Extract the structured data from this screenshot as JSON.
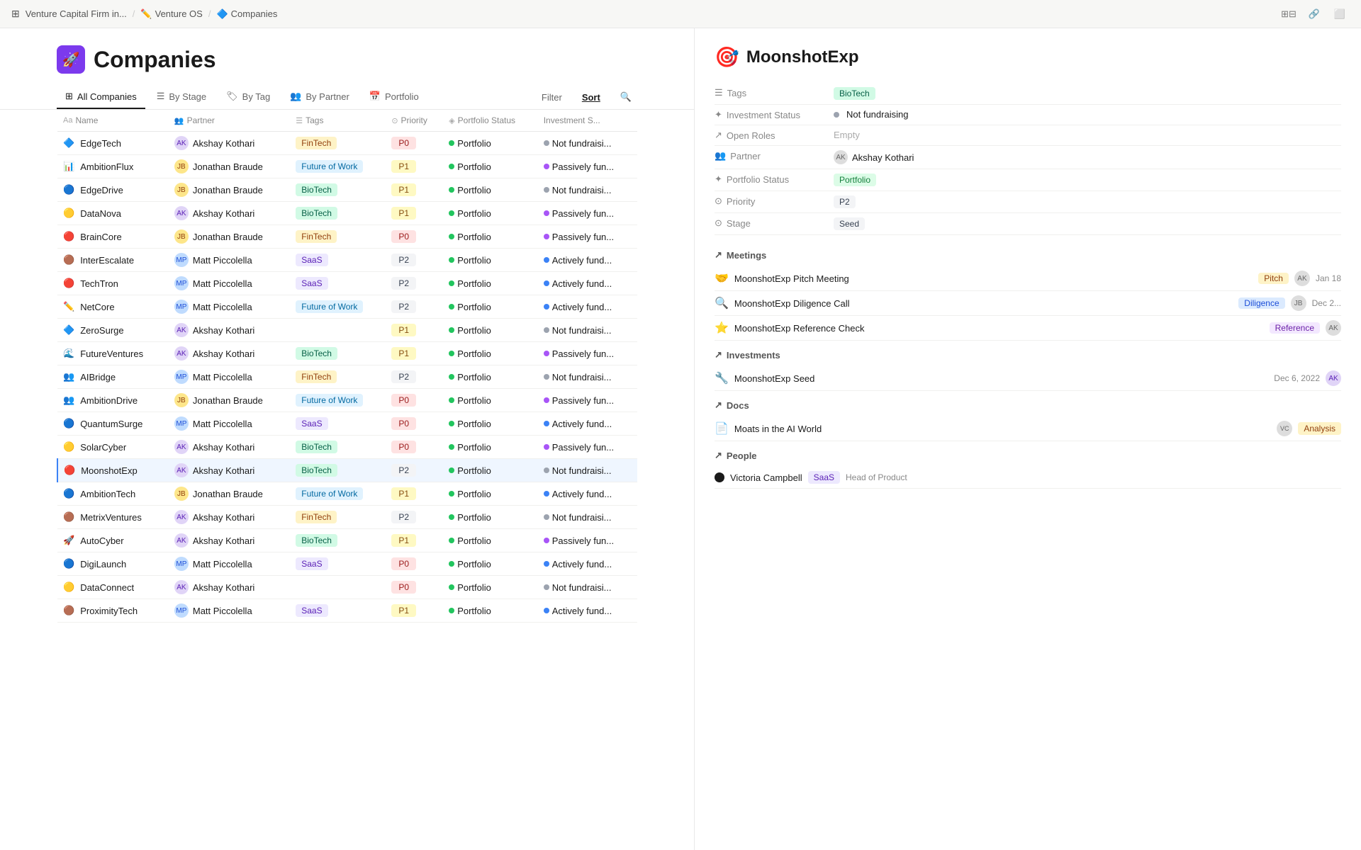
{
  "topbar": {
    "breadcrumbs": [
      "Venture Capital Firm in...",
      "Venture OS",
      "Companies"
    ],
    "icons": [
      "grid-icon",
      "link-icon",
      "layout-icon"
    ]
  },
  "page": {
    "icon": "🚀",
    "title": "Companies"
  },
  "tabs": [
    {
      "label": "All Companies",
      "icon": "⊞",
      "active": true
    },
    {
      "label": "By Stage",
      "icon": "☰",
      "active": false
    },
    {
      "label": "By Tag",
      "icon": "🏷",
      "active": false
    },
    {
      "label": "By Partner",
      "icon": "👥",
      "active": false
    },
    {
      "label": "Portfolio",
      "icon": "📅",
      "active": false
    }
  ],
  "table_actions": {
    "filter": "Filter",
    "sort": "Sort",
    "search_icon": "search-icon"
  },
  "columns": [
    {
      "label": "Name",
      "icon": "Aa"
    },
    {
      "label": "Partner",
      "icon": "👥"
    },
    {
      "label": "Tags",
      "icon": "☰"
    },
    {
      "label": "Priority",
      "icon": "⊙"
    },
    {
      "label": "Portfolio Status",
      "icon": "◈"
    },
    {
      "label": "Investment S..."
    }
  ],
  "rows": [
    {
      "name": "EdgeTech",
      "icon": "🔷",
      "partner": "Akshay Kothari",
      "partner_icon": "AK",
      "tag": "FinTech",
      "tag_class": "tag-fintech",
      "priority": "P0",
      "priority_class": "p0",
      "portfolio": "Portfolio",
      "portfolio_dot": "dot-green",
      "investment": "Not fundraisi...",
      "investment_dot": "dot-gray"
    },
    {
      "name": "AmbitionFlux",
      "icon": "📊",
      "partner": "Jonathan Braude",
      "partner_icon": "JB",
      "tag": "Future of Work",
      "tag_class": "tag-future",
      "priority": "P1",
      "priority_class": "p1",
      "portfolio": "Portfolio",
      "portfolio_dot": "dot-green",
      "investment": "Passively fun...",
      "investment_dot": "dot-purple"
    },
    {
      "name": "EdgeDrive",
      "icon": "🔵",
      "partner": "Jonathan Braude",
      "partner_icon": "JB",
      "tag": "BioTech",
      "tag_class": "tag-biotech",
      "priority": "P1",
      "priority_class": "p1",
      "portfolio": "Portfolio",
      "portfolio_dot": "dot-green",
      "investment": "Not fundraisi...",
      "investment_dot": "dot-gray"
    },
    {
      "name": "DataNova",
      "icon": "🟡",
      "partner": "Akshay Kothari",
      "partner_icon": "AK",
      "tag": "BioTech",
      "tag_class": "tag-biotech",
      "priority": "P1",
      "priority_class": "p1",
      "portfolio": "Portfolio",
      "portfolio_dot": "dot-green",
      "investment": "Passively fun...",
      "investment_dot": "dot-purple"
    },
    {
      "name": "BrainCore",
      "icon": "🔴",
      "partner": "Jonathan Braude",
      "partner_icon": "JB",
      "tag": "FinTech",
      "tag_class": "tag-fintech",
      "priority": "P0",
      "priority_class": "p0",
      "portfolio": "Portfolio",
      "portfolio_dot": "dot-green",
      "investment": "Passively fun...",
      "investment_dot": "dot-purple"
    },
    {
      "name": "InterEscalate",
      "icon": "🟤",
      "partner": "Matt Piccolella",
      "partner_icon": "MP",
      "tag": "SaaS",
      "tag_class": "tag-saas",
      "priority": "P2",
      "priority_class": "p2",
      "portfolio": "Portfolio",
      "portfolio_dot": "dot-green",
      "investment": "Actively fund...",
      "investment_dot": "dot-blue"
    },
    {
      "name": "TechTron",
      "icon": "🔴",
      "partner": "Matt Piccolella",
      "partner_icon": "MP",
      "tag": "SaaS",
      "tag_class": "tag-saas",
      "priority": "P2",
      "priority_class": "p2",
      "portfolio": "Portfolio",
      "portfolio_dot": "dot-green",
      "investment": "Actively fund...",
      "investment_dot": "dot-blue"
    },
    {
      "name": "NetCore",
      "icon": "✏️",
      "partner": "Matt Piccolella",
      "partner_icon": "MP",
      "tag": "Future of Work",
      "tag_class": "tag-future",
      "priority": "P2",
      "priority_class": "p2",
      "portfolio": "Portfolio",
      "portfolio_dot": "dot-green",
      "investment": "Actively fund...",
      "investment_dot": "dot-blue"
    },
    {
      "name": "ZeroSurge",
      "icon": "🔷",
      "partner": "Akshay Kothari",
      "partner_icon": "AK",
      "tag": "",
      "tag_class": "",
      "priority": "P1",
      "priority_class": "p1",
      "portfolio": "Portfolio",
      "portfolio_dot": "dot-green",
      "investment": "Not fundraisi...",
      "investment_dot": "dot-gray"
    },
    {
      "name": "FutureVentures",
      "icon": "🌊",
      "partner": "Akshay Kothari",
      "partner_icon": "AK",
      "tag": "BioTech",
      "tag_class": "tag-biotech",
      "priority": "P1",
      "priority_class": "p1",
      "portfolio": "Portfolio",
      "portfolio_dot": "dot-green",
      "investment": "Passively fun...",
      "investment_dot": "dot-purple"
    },
    {
      "name": "AIBridge",
      "icon": "👥",
      "partner": "Matt Piccolella",
      "partner_icon": "MP",
      "tag": "FinTech",
      "tag_class": "tag-fintech",
      "priority": "P2",
      "priority_class": "p2",
      "portfolio": "Portfolio",
      "portfolio_dot": "dot-green",
      "investment": "Not fundraisi...",
      "investment_dot": "dot-gray"
    },
    {
      "name": "AmbitionDrive",
      "icon": "👥",
      "partner": "Jonathan Braude",
      "partner_icon": "JB",
      "tag": "Future of Work",
      "tag_class": "tag-future",
      "priority": "P0",
      "priority_class": "p0",
      "portfolio": "Portfolio",
      "portfolio_dot": "dot-green",
      "investment": "Passively fun...",
      "investment_dot": "dot-purple"
    },
    {
      "name": "QuantumSurge",
      "icon": "🔵",
      "partner": "Matt Piccolella",
      "partner_icon": "MP",
      "tag": "SaaS",
      "tag_class": "tag-saas",
      "priority": "P0",
      "priority_class": "p0",
      "portfolio": "Portfolio",
      "portfolio_dot": "dot-green",
      "investment": "Actively fund...",
      "investment_dot": "dot-blue"
    },
    {
      "name": "SolarCyber",
      "icon": "🟡",
      "partner": "Akshay Kothari",
      "partner_icon": "AK",
      "tag": "BioTech",
      "tag_class": "tag-biotech",
      "priority": "P0",
      "priority_class": "p0",
      "portfolio": "Portfolio",
      "portfolio_dot": "dot-green",
      "investment": "Passively fun...",
      "investment_dot": "dot-purple"
    },
    {
      "name": "MoonshotExp",
      "icon": "🔴",
      "partner": "Akshay Kothari",
      "partner_icon": "AK",
      "tag": "BioTech",
      "tag_class": "tag-biotech",
      "priority": "P2",
      "priority_class": "p2",
      "portfolio": "Portfolio",
      "portfolio_dot": "dot-green",
      "investment": "Not fundraisi...",
      "investment_dot": "dot-gray",
      "selected": true
    },
    {
      "name": "AmbitionTech",
      "icon": "🔵",
      "partner": "Jonathan Braude",
      "partner_icon": "JB",
      "tag": "Future of Work",
      "tag_class": "tag-future",
      "priority": "P1",
      "priority_class": "p1",
      "portfolio": "Portfolio",
      "portfolio_dot": "dot-green",
      "investment": "Actively fund...",
      "investment_dot": "dot-blue"
    },
    {
      "name": "MetrixVentures",
      "icon": "🟤",
      "partner": "Akshay Kothari",
      "partner_icon": "AK",
      "tag": "FinTech",
      "tag_class": "tag-fintech",
      "priority": "P2",
      "priority_class": "p2",
      "portfolio": "Portfolio",
      "portfolio_dot": "dot-green",
      "investment": "Not fundraisi...",
      "investment_dot": "dot-gray"
    },
    {
      "name": "AutoCyber",
      "icon": "🚀",
      "partner": "Akshay Kothari",
      "partner_icon": "AK",
      "tag": "BioTech",
      "tag_class": "tag-biotech",
      "priority": "P1",
      "priority_class": "p1",
      "portfolio": "Portfolio",
      "portfolio_dot": "dot-green",
      "investment": "Passively fun...",
      "investment_dot": "dot-purple"
    },
    {
      "name": "DigiLaunch",
      "icon": "🔵",
      "partner": "Matt Piccolella",
      "partner_icon": "MP",
      "tag": "SaaS",
      "tag_class": "tag-saas",
      "priority": "P0",
      "priority_class": "p0",
      "portfolio": "Portfolio",
      "portfolio_dot": "dot-green",
      "investment": "Actively fund...",
      "investment_dot": "dot-blue"
    },
    {
      "name": "DataConnect",
      "icon": "🟡",
      "partner": "Akshay Kothari",
      "partner_icon": "AK",
      "tag": "",
      "tag_class": "",
      "priority": "P0",
      "priority_class": "p0",
      "portfolio": "Portfolio",
      "portfolio_dot": "dot-green",
      "investment": "Not fundraisi...",
      "investment_dot": "dot-gray"
    },
    {
      "name": "ProximityTech",
      "icon": "🟤",
      "partner": "Matt Piccolella",
      "partner_icon": "MP",
      "tag": "SaaS",
      "tag_class": "tag-saas",
      "priority": "P1",
      "priority_class": "p1",
      "portfolio": "Portfolio",
      "portfolio_dot": "dot-green",
      "investment": "Actively fund...",
      "investment_dot": "dot-blue"
    }
  ],
  "detail": {
    "name": "MoonshotExp",
    "icon": "🎯",
    "tags_label": "Tags",
    "tags_value": "BioTech",
    "investment_status_label": "Investment Status",
    "investment_status_value": "Not fundraising",
    "open_roles_label": "Open Roles",
    "open_roles_value": "Empty",
    "partner_label": "Partner",
    "partner_value": "Akshay Kothari",
    "portfolio_status_label": "Portfolio Status",
    "portfolio_status_value": "Portfolio",
    "priority_label": "Priority",
    "priority_value": "P2",
    "stage_label": "Stage",
    "stage_value": "Seed",
    "meetings_label": "Meetings",
    "meetings": [
      {
        "icon": "🤝",
        "name": "MoonshotExp Pitch Meeting",
        "tag": "Pitch",
        "tag_class": "tag-pitch",
        "date": "Jan 18",
        "avatar": "AK"
      },
      {
        "icon": "🔍",
        "name": "MoonshotExp Diligence Call",
        "tag": "Diligence",
        "tag_class": "tag-diligence",
        "date": "Dec 2...",
        "avatar": "JB"
      },
      {
        "icon": "⭐",
        "name": "MoonshotExp Reference Check",
        "tag": "Reference",
        "tag_class": "tag-reference",
        "date": "",
        "avatar": "AK"
      }
    ],
    "investments_label": "Investments",
    "investments": [
      {
        "icon": "🔧",
        "name": "MoonshotExp Seed",
        "date": "Dec 6, 2022",
        "avatar": "AK"
      }
    ],
    "docs_label": "Docs",
    "docs": [
      {
        "icon": "📄",
        "name": "Moats in the AI World",
        "tag": "Analysis",
        "tag_class": "badge-analysis",
        "avatar": "VC"
      }
    ],
    "people_label": "People",
    "people": [
      {
        "name": "Victoria Campbell",
        "tag": "SaaS",
        "tag_class": "badge-saas",
        "role": "Head of Product"
      }
    ]
  }
}
